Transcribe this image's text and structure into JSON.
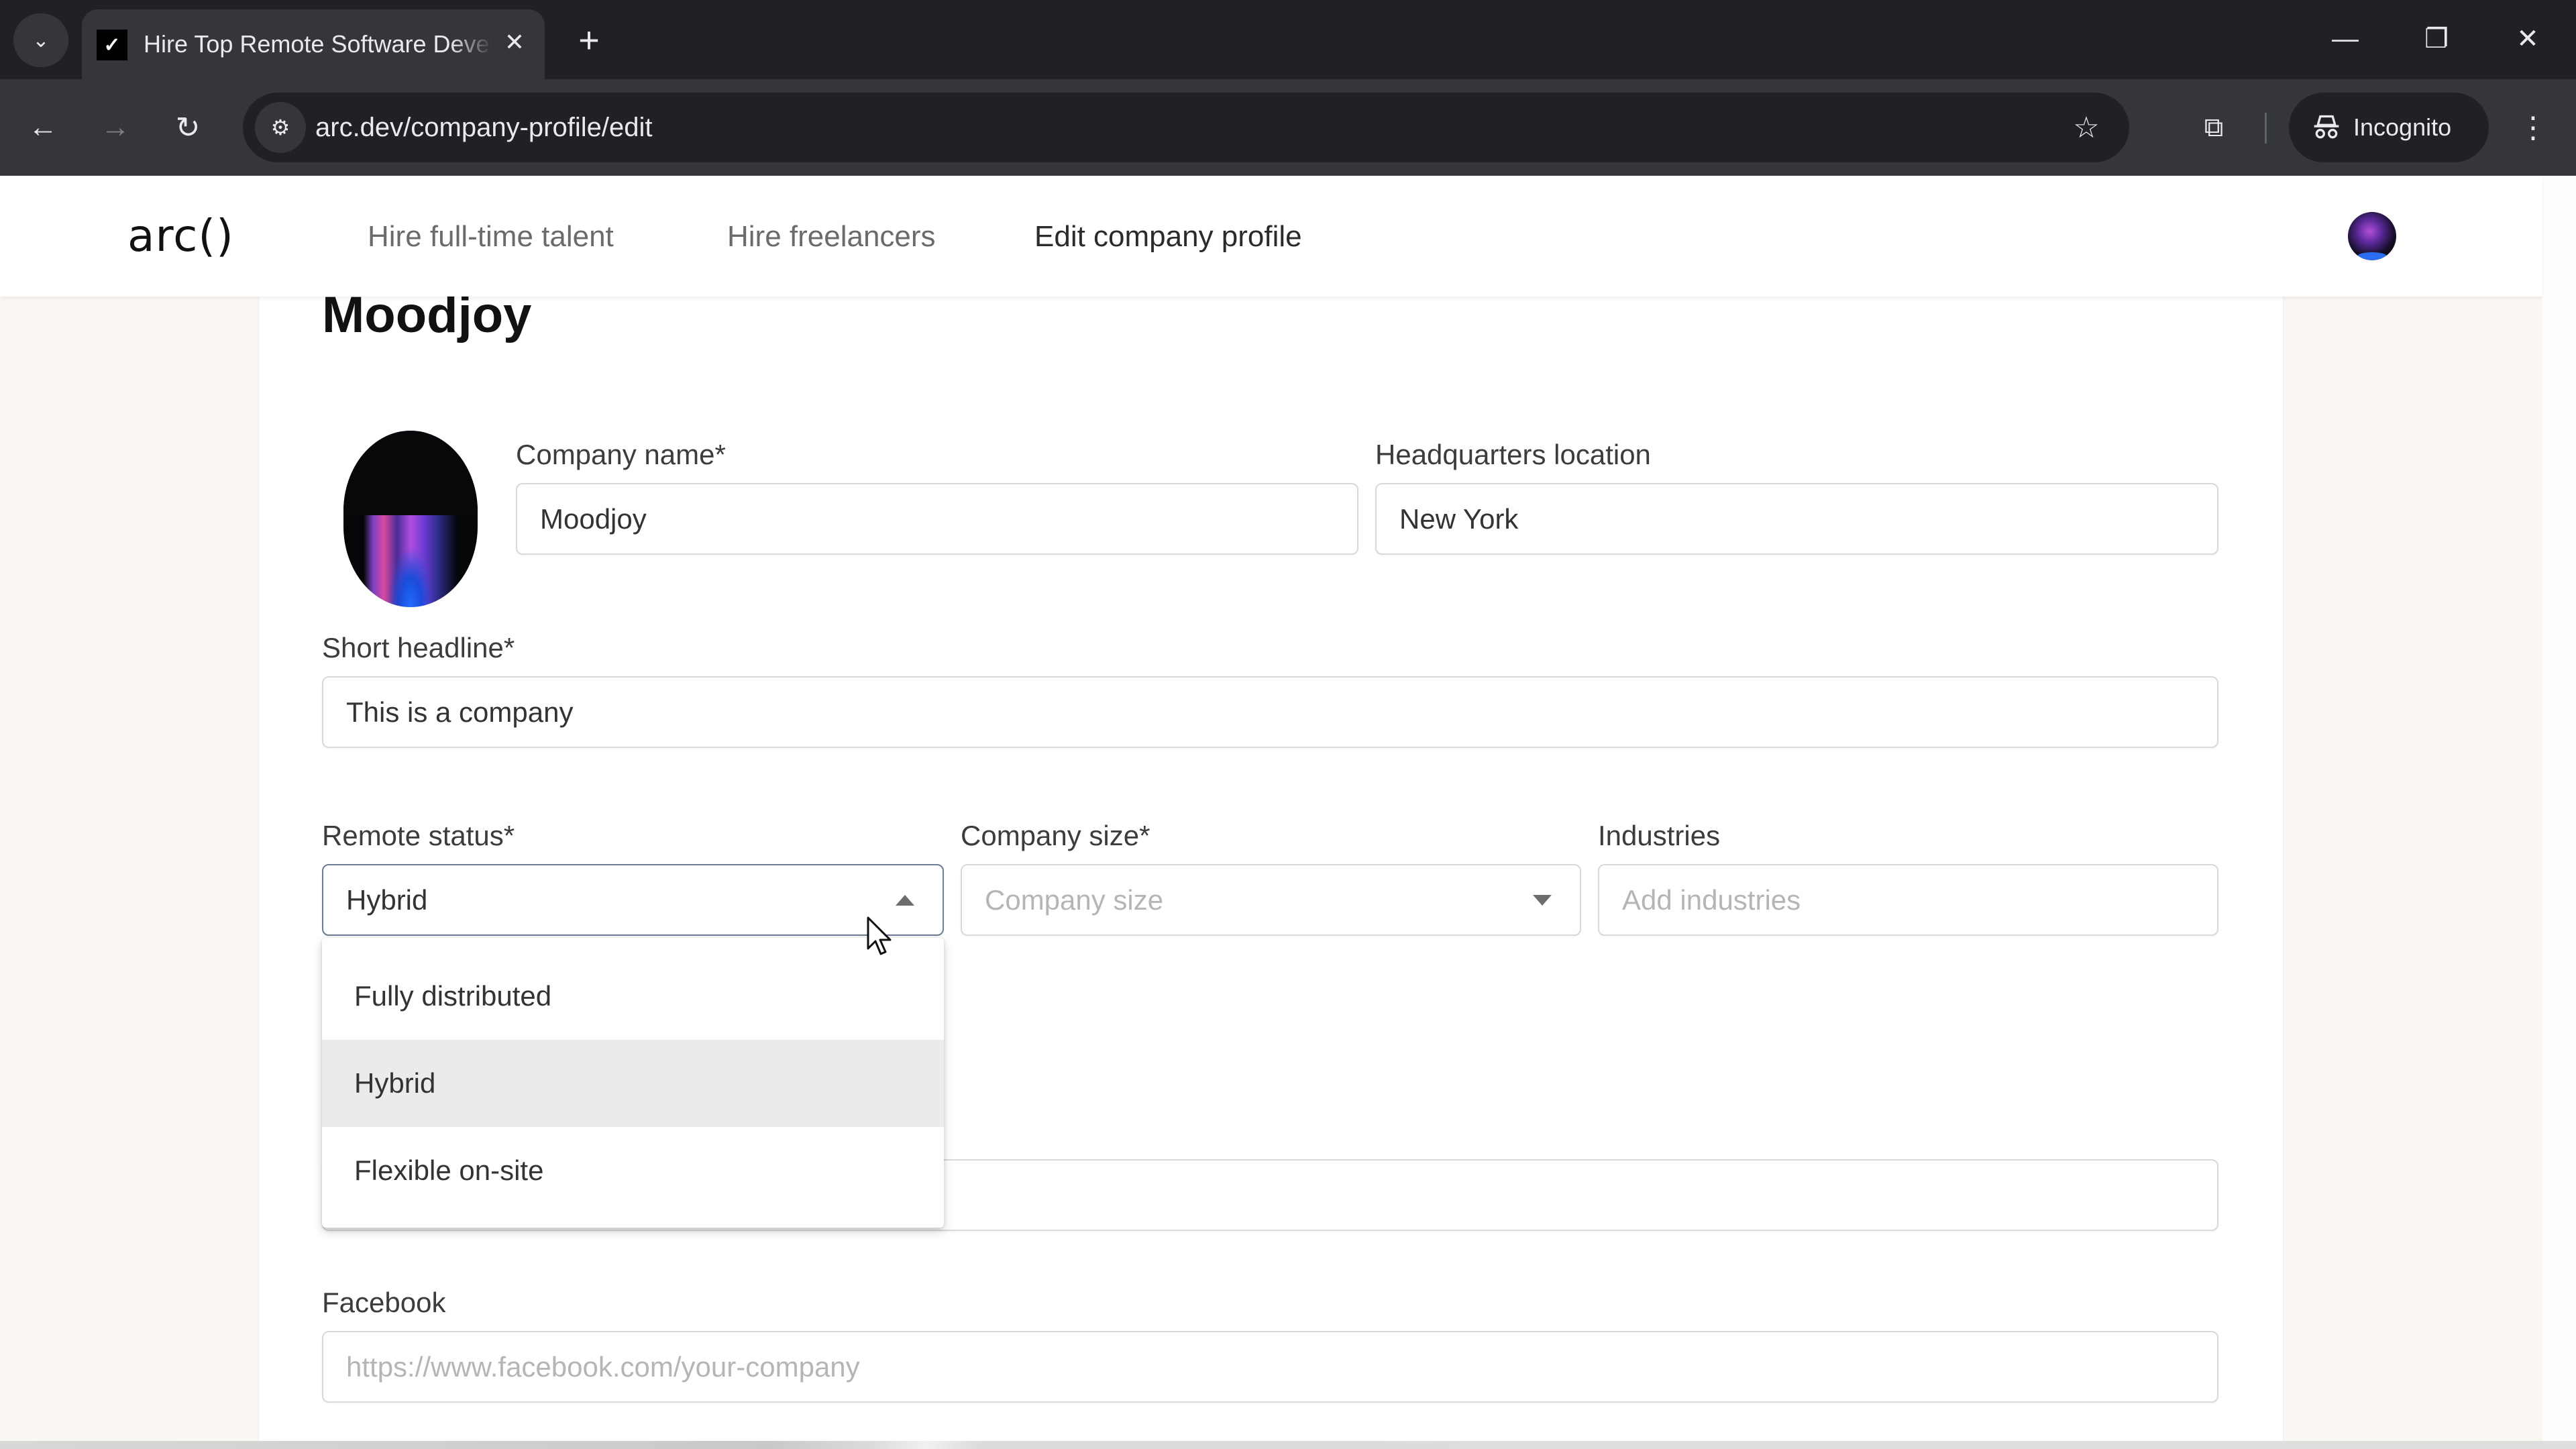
{
  "browser": {
    "tab_title": "Hire Top Remote Software Developers",
    "url": "arc.dev/company-profile/edit",
    "incognito_label": "Incognito",
    "icons": {
      "tab_list": "chevron-down-icon",
      "favicon": "arc-check-icon",
      "close_tab": "close-icon",
      "new_tab": "plus-icon",
      "back": "arrow-left-icon",
      "forward": "arrow-right-icon",
      "reload": "reload-icon",
      "site_info": "tune-icon",
      "bookmark": "star-icon",
      "extensions": "puzzle-icon",
      "incognito": "incognito-icon",
      "menu": "kebab-menu-icon",
      "minimize": "minimize-icon",
      "restore": "restore-icon",
      "close_window": "close-icon"
    },
    "glyphs": {
      "tab_list": "⌄",
      "favicon": "✓",
      "close": "✕",
      "new_tab": "+",
      "back": "←",
      "forward": "→",
      "reload": "↻",
      "site_info": "⚙",
      "star": "☆",
      "puzzle": "⧉",
      "incognito": "🕵",
      "menu": "⋮",
      "minimize": "—",
      "restore": "❐"
    }
  },
  "site": {
    "logo": "arc()",
    "nav": [
      {
        "label": "Hire full-time talent",
        "active": false
      },
      {
        "label": "Hire freelancers",
        "active": false
      },
      {
        "label": "Edit company profile",
        "active": true
      }
    ]
  },
  "form": {
    "page_title": "Moodjoy",
    "company_name": {
      "label": "Company name*",
      "value": "Moodjoy"
    },
    "hq_location": {
      "label": "Headquarters location",
      "value": "New York"
    },
    "short_headline": {
      "label": "Short headline*",
      "value": "This is a company"
    },
    "remote_status": {
      "label": "Remote status*",
      "value": "Hybrid",
      "open": true,
      "options": [
        "Fully distributed",
        "Hybrid",
        "Flexible on-site"
      ],
      "selected_index": 1
    },
    "company_size": {
      "label": "Company size*",
      "placeholder": "Company size",
      "value": ""
    },
    "industries": {
      "label": "Industries",
      "placeholder": "Add industries",
      "value": ""
    },
    "facebook": {
      "label": "Facebook",
      "placeholder": "https://www.facebook.com/your-company",
      "value": ""
    }
  },
  "colors": {
    "page_bg": "#faf7f2",
    "chrome_dark": "#202124",
    "chrome_toolbar": "#35363a",
    "selected_option_bg": "#ebebeb",
    "focused_border": "#6c7d96"
  }
}
